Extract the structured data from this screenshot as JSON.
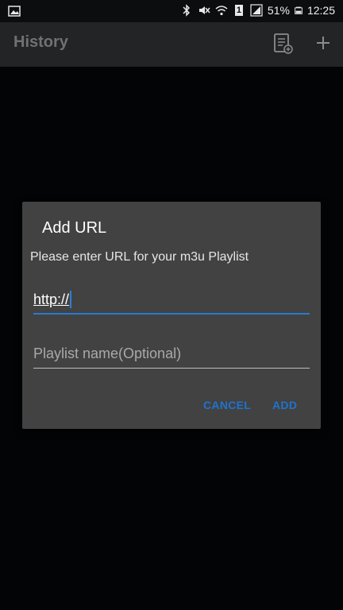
{
  "status_bar": {
    "battery_percent": "51%",
    "time": "12:25",
    "sim_badge": "1",
    "icons": [
      "image-icon",
      "bluetooth-icon",
      "mute-icon",
      "wifi-icon",
      "sim-icon",
      "signal-icon",
      "battery-icon"
    ]
  },
  "app_bar": {
    "title": "History",
    "actions": [
      "playlist-icon",
      "add-icon"
    ]
  },
  "dialog": {
    "title": "Add URL",
    "message": "Please enter URL for your m3u Playlist",
    "url_field": {
      "value": "http://",
      "placeholder": ""
    },
    "name_field": {
      "value": "",
      "placeholder": "Playlist name(Optional)"
    },
    "cancel_label": "CANCEL",
    "add_label": "ADD"
  },
  "colors": {
    "accent": "#1f73cf",
    "dialog_bg": "#424242",
    "app_bar_bg": "#222425",
    "background": "#020405"
  }
}
